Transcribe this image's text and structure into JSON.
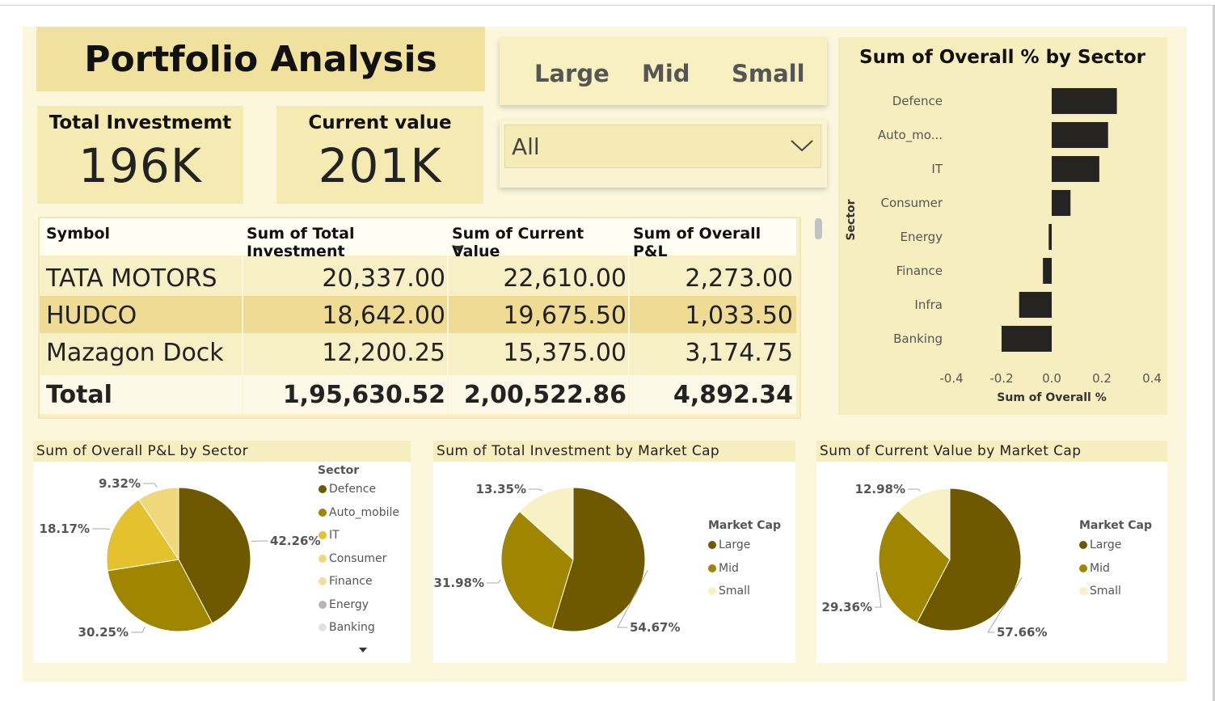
{
  "title": "Portfolio Analysis",
  "kpis": {
    "total_investment": {
      "label": "Total Investmemt",
      "value": "196K"
    },
    "current_value": {
      "label": "Current value",
      "value": "201K"
    }
  },
  "market_cap_slicer": {
    "options": [
      "Large",
      "Mid",
      "Small"
    ]
  },
  "sector_dropdown": {
    "value": "All"
  },
  "table": {
    "columns": [
      "Symbol",
      "Sum of Total Investment",
      "Sum of Current Value",
      "Sum of Overall P&L"
    ],
    "rows": [
      {
        "symbol": "TATA MOTORS",
        "investment": "20,337.00",
        "current": "22,610.00",
        "pnl": "2,273.00"
      },
      {
        "symbol": "HUDCO",
        "investment": "18,642.00",
        "current": "19,675.50",
        "pnl": "1,033.50"
      },
      {
        "symbol": "Mazagon Dock",
        "investment": "12,200.25",
        "current": "15,375.00",
        "pnl": "3,174.75"
      }
    ],
    "total": {
      "label": "Total",
      "investment": "1,95,630.52",
      "current": "2,00,522.86",
      "pnl": "4,892.34"
    }
  },
  "chart_data": [
    {
      "type": "bar",
      "orientation": "horizontal",
      "title": "Sum of Overall % by Sector",
      "xlabel": "Sum of Overall %",
      "ylabel": "Sector",
      "categories": [
        "Defence",
        "Auto_mo...",
        "IT",
        "Consumer",
        "Energy",
        "Finance",
        "Infra",
        "Banking"
      ],
      "values": [
        0.26,
        0.225,
        0.19,
        0.075,
        -0.012,
        -0.035,
        -0.13,
        -0.2
      ],
      "xlim": [
        -0.4,
        0.4
      ],
      "xticks": [
        "-0.4",
        "-0.2",
        "0.0",
        "0.2",
        "0.4"
      ],
      "color": "#252423",
      "grid": false
    },
    {
      "type": "pie",
      "title": "Sum of Overall P&L by Sector",
      "legend_title": "Sector",
      "legend": [
        "Defence",
        "Auto_mobile",
        "IT",
        "Consumer",
        "Finance",
        "Energy",
        "Banking"
      ],
      "legend_colors": [
        "#6e5900",
        "#a08600",
        "#e4c12e",
        "#eed87a",
        "#f3df9c",
        "#b5b5b5",
        "#e2e2e2"
      ],
      "slices": [
        {
          "name": "Defence",
          "value": 42.26,
          "label": "42.26%",
          "color": "#6e5900"
        },
        {
          "name": "Auto_mobile",
          "value": 30.25,
          "label": "30.25%",
          "color": "#a08600"
        },
        {
          "name": "IT",
          "value": 18.17,
          "label": "18.17%",
          "color": "#e4c12e"
        },
        {
          "name": "Consumer",
          "value": 9.32,
          "label": "9.32%",
          "color": "#eed87a"
        }
      ]
    },
    {
      "type": "pie",
      "title": "Sum of Total Investment by Market Cap",
      "legend_title": "Market Cap",
      "legend": [
        "Large",
        "Mid",
        "Small"
      ],
      "legend_colors": [
        "#6e5900",
        "#a08600",
        "#f8f1c6"
      ],
      "slices": [
        {
          "name": "Large",
          "value": 54.67,
          "label": "54.67%",
          "color": "#6e5900"
        },
        {
          "name": "Mid",
          "value": 31.98,
          "label": "31.98%",
          "color": "#a08600"
        },
        {
          "name": "Small",
          "value": 13.35,
          "label": "13.35%",
          "color": "#f8f1c6"
        }
      ]
    },
    {
      "type": "pie",
      "title": "Sum of Current Value by Market Cap",
      "legend_title": "Market Cap",
      "legend": [
        "Large",
        "Mid",
        "Small"
      ],
      "legend_colors": [
        "#6e5900",
        "#a08600",
        "#f8f1c6"
      ],
      "slices": [
        {
          "name": "Large",
          "value": 57.66,
          "label": "57.66%",
          "color": "#6e5900"
        },
        {
          "name": "Mid",
          "value": 29.36,
          "label": "29.36%",
          "color": "#a08600"
        },
        {
          "name": "Small",
          "value": 12.98,
          "label": "12.98%",
          "color": "#f8f1c6"
        }
      ]
    }
  ]
}
